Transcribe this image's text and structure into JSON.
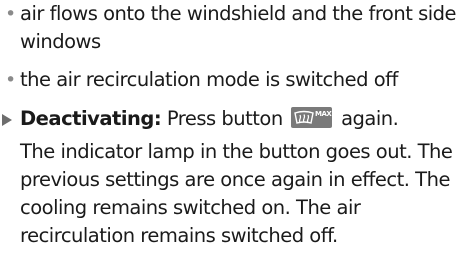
{
  "bullets": [
    "air flows onto the windshield and the front side windows",
    "the air recirculation mode is switched off"
  ],
  "action": {
    "label": "Deactivating:",
    "text_before": "Press button",
    "button_icon": "defrost-max-icon",
    "button_badge": "MAX",
    "text_after": "again."
  },
  "result": "The indicator lamp in the button goes out. The previous settings are once again in effect. The cooling remains switched on. The air recirculation remains switched off.",
  "colors": {
    "text": "#1a1a1a",
    "bullet": "#8a8a8a",
    "arrow": "#6d6d6d",
    "button_bg": "#7a7a7a"
  }
}
